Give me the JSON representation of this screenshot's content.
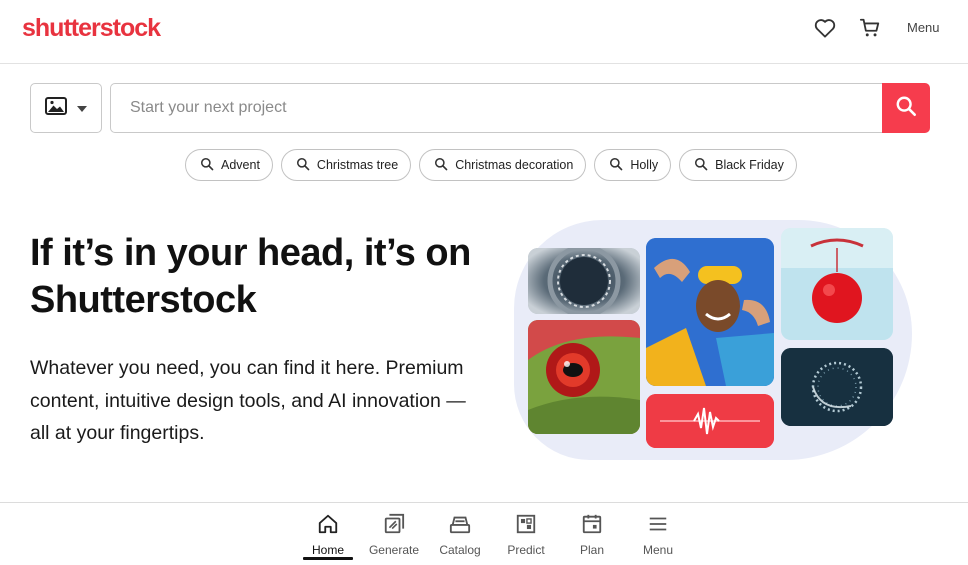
{
  "header": {
    "logo": "shutterstock",
    "menu_label": "Menu",
    "icons": [
      "heart-icon",
      "cart-icon"
    ]
  },
  "search": {
    "type_icon": "image-icon",
    "placeholder": "Start your next project",
    "value": "",
    "button_icon": "search-icon",
    "accent": "#f63c4d"
  },
  "suggestions": [
    {
      "label": "Advent"
    },
    {
      "label": "Christmas tree"
    },
    {
      "label": "Christmas decoration"
    },
    {
      "label": "Holly"
    },
    {
      "label": "Black Friday"
    }
  ],
  "hero": {
    "title": "If it’s in your head, it’s on Shutterstock",
    "subtitle": "Whatever you need, you can find it here. Premium content, intuitive design tools, and AI innovation — all at your fingertips."
  },
  "bottom_nav": {
    "active": "Home",
    "items": [
      {
        "label": "Home",
        "icon": "home-icon"
      },
      {
        "label": "Generate",
        "icon": "generate-icon"
      },
      {
        "label": "Catalog",
        "icon": "catalog-icon"
      },
      {
        "label": "Predict",
        "icon": "predict-icon"
      },
      {
        "label": "Plan",
        "icon": "calendar-icon"
      },
      {
        "label": "Menu",
        "icon": "hamburger-icon"
      }
    ]
  },
  "colors": {
    "brand": "#e8333f",
    "search_button": "#f63c4d",
    "text": "#111111"
  }
}
